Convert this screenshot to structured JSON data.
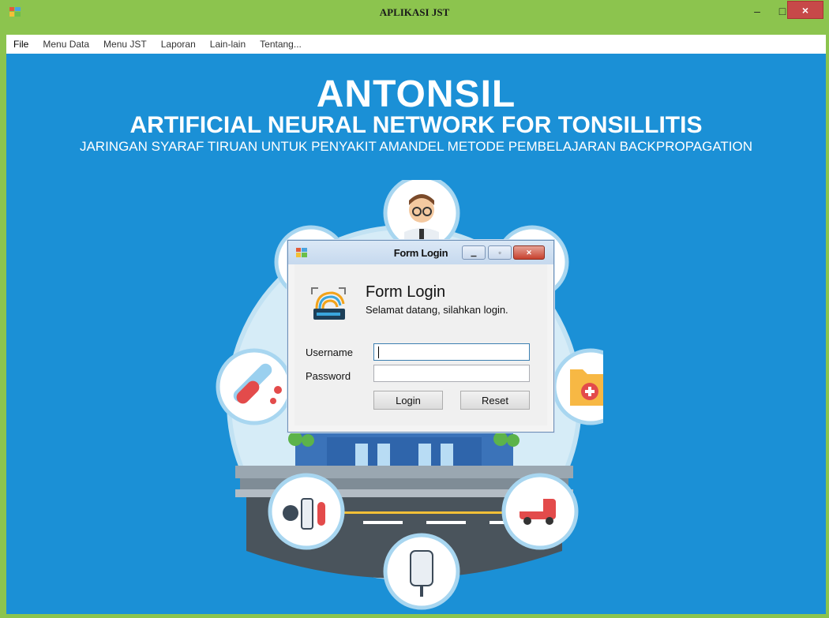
{
  "window": {
    "title": "APLIKASI JST",
    "controls": {
      "minimize": "–",
      "maximize": "□",
      "close": "×"
    }
  },
  "menubar": {
    "items": [
      "File",
      "Menu Data",
      "Menu JST",
      "Laporan",
      "Lain-lain",
      "Tentang..."
    ]
  },
  "hero": {
    "title": "ANTONSIL",
    "subtitle": "ARTIFICIAL NEURAL NETWORK FOR TONSILLITIS",
    "description": "JARINGAN SYARAF TIRUAN UNTUK PENYAKIT AMANDEL METODE PEMBELAJARAN BACKPROPAGATION"
  },
  "login_dialog": {
    "title": "Form Login",
    "heading": "Form Login",
    "welcome": "Selamat datang, silahkan login.",
    "username_label": "Username",
    "password_label": "Password",
    "username_value": "",
    "password_value": "",
    "login_button": "Login",
    "reset_button": "Reset"
  },
  "colors": {
    "window_frame": "#8cc44e",
    "background": "#1b90d6",
    "close_button": "#c74949"
  }
}
